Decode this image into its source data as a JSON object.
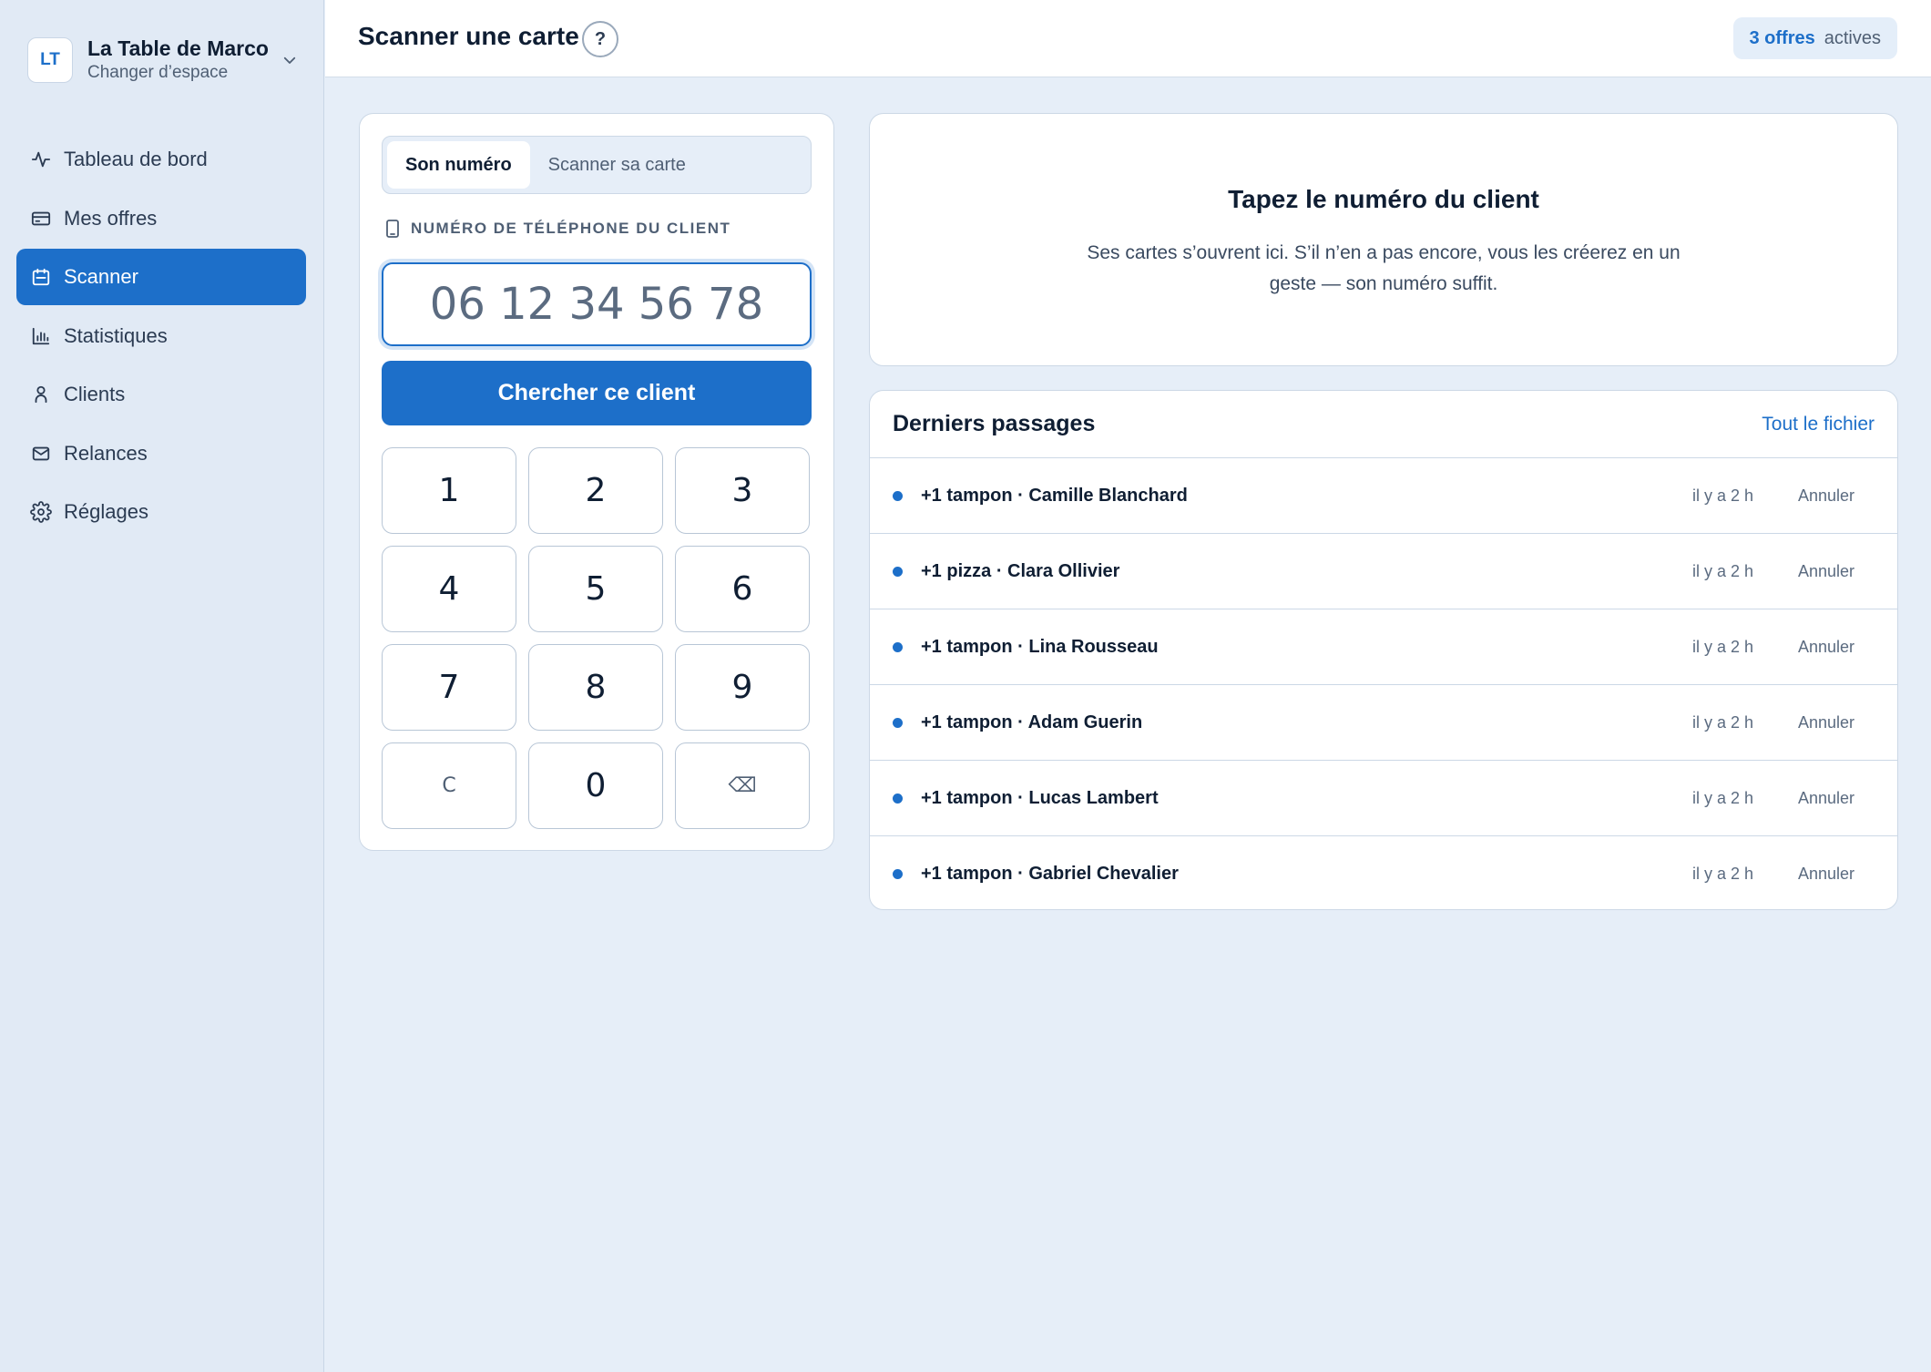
{
  "workspace": {
    "initials": "LT",
    "name": "La Table de Marco",
    "subtitle": "Changer d’espace"
  },
  "sidebar": {
    "items": [
      {
        "label": "Tableau de bord",
        "icon": "activity-icon",
        "active": false
      },
      {
        "label": "Mes offres",
        "icon": "card-icon",
        "active": false
      },
      {
        "label": "Scanner",
        "icon": "scan-icon",
        "active": true
      },
      {
        "label": "Statistiques",
        "icon": "bar-chart-icon",
        "active": false
      },
      {
        "label": "Clients",
        "icon": "user-icon",
        "active": false
      },
      {
        "label": "Relances",
        "icon": "mail-icon",
        "active": false
      },
      {
        "label": "Réglages",
        "icon": "gear-icon",
        "active": false
      }
    ]
  },
  "header": {
    "title": "Scanner une carte",
    "help": "?",
    "offers_count": "3 offres",
    "offers_label": "actives"
  },
  "scan": {
    "tabs": [
      {
        "label": "Son numéro",
        "active": true
      },
      {
        "label": "Scanner sa carte",
        "active": false
      }
    ],
    "field_label": "NUMÉRO DE TÉLÉPHONE DU CLIENT",
    "phone_placeholder": "06 12 34 56 78",
    "search_button": "Chercher ce client",
    "keys": [
      "1",
      "2",
      "3",
      "4",
      "5",
      "6",
      "7",
      "8",
      "9",
      "C",
      "0",
      "⌫"
    ]
  },
  "info": {
    "title": "Tapez le numéro du client",
    "text": "Ses cartes s’ouvrent ici. S’il n’en a pas encore, vous les créerez en un geste — son numéro suffit."
  },
  "recent": {
    "title": "Derniers passages",
    "link": "Tout le fichier",
    "rows": [
      {
        "desc": "+1 tampon · Camille Blanchard",
        "time": "il y a 2 h",
        "action": "Annuler"
      },
      {
        "desc": "+1 pizza · Clara Ollivier",
        "time": "il y a 2 h",
        "action": "Annuler"
      },
      {
        "desc": "+1 tampon · Lina Rousseau",
        "time": "il y a 2 h",
        "action": "Annuler"
      },
      {
        "desc": "+1 tampon · Adam Guerin",
        "time": "il y a 2 h",
        "action": "Annuler"
      },
      {
        "desc": "+1 tampon · Lucas Lambert",
        "time": "il y a 2 h",
        "action": "Annuler"
      },
      {
        "desc": "+1 tampon · Gabriel Chevalier",
        "time": "il y a 2 h",
        "action": "Annuler"
      }
    ]
  },
  "colors": {
    "accent": "#1d6fc9",
    "background": "#e6eef8",
    "sidebar": "#e1eaf5"
  }
}
